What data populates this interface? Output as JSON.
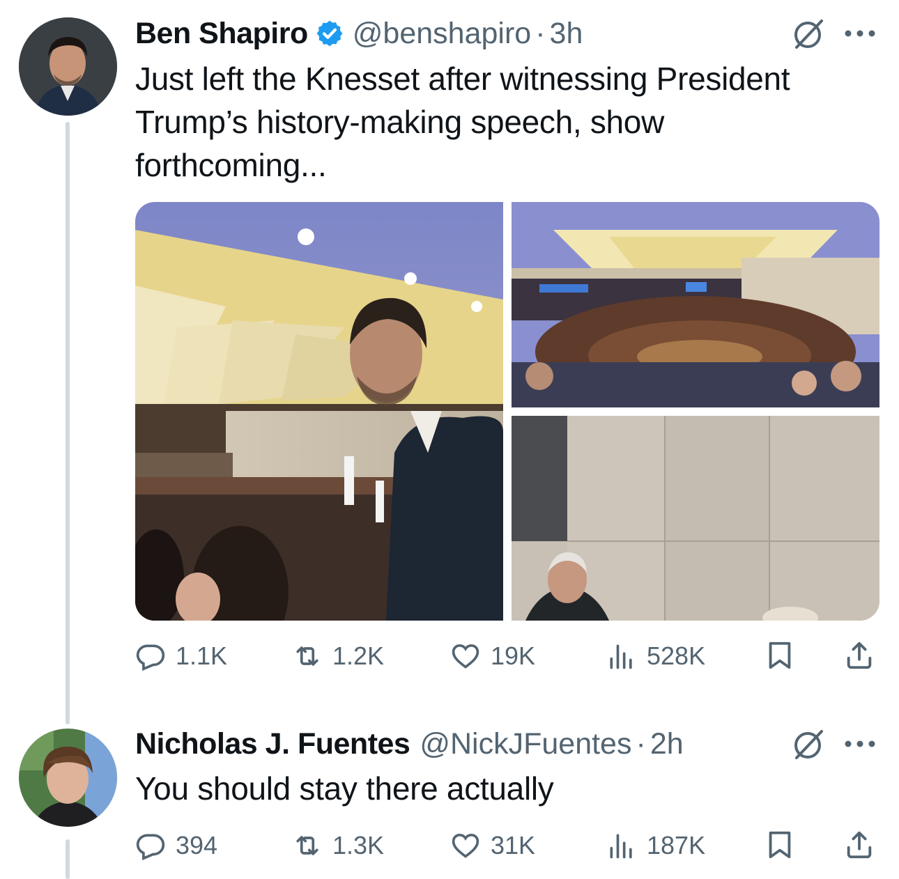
{
  "tweets": [
    {
      "author_name": "Ben Shapiro",
      "verified": true,
      "handle": "@benshapiro",
      "separator": "·",
      "time": "3h",
      "text": "Just left the Knesset after witnessing President Trump’s history-making speech, show forthcoming...",
      "text_lines": [
        "Just left the Knesset after witnessing President",
        "Trump’s history-making speech, show",
        "forthcoming..."
      ],
      "media_count": 3,
      "replies": "1.1K",
      "reposts": "1.2K",
      "likes": "19K",
      "views": "528K"
    },
    {
      "author_name": "Nicholas J. Fuentes",
      "verified": false,
      "handle": "@NickJFuentes",
      "separator": "·",
      "time": "2h",
      "text": "You should stay there actually",
      "replies": "394",
      "reposts": "1.3K",
      "likes": "31K",
      "views": "187K"
    }
  ],
  "icons": {
    "reply": "reply-icon",
    "repost": "repost-icon",
    "like": "heart-icon",
    "views": "views-icon",
    "bookmark": "bookmark-icon",
    "share": "share-icon",
    "grok": "grok-icon",
    "more": "more-icon",
    "verified": "verified-badge-icon"
  },
  "colors": {
    "text": "#0f1419",
    "secondary": "#536471",
    "verified": "#1d9bf0",
    "thread_line": "#cfd9de"
  }
}
